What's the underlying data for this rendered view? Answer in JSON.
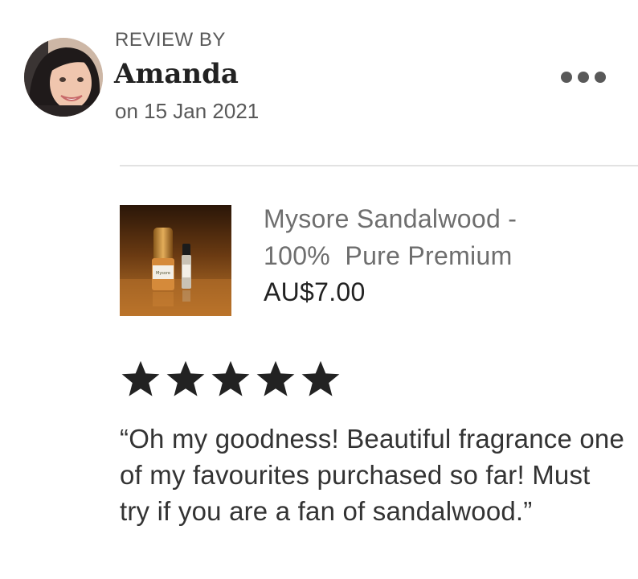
{
  "review": {
    "header_label": "REVIEW BY",
    "reviewer_name": "Amanda",
    "date": "on 15 Jan 2021",
    "more_options_icon": "more-horizontal-icon"
  },
  "product": {
    "title": "Mysore Sandalwood -\n100%  Pure Premium",
    "price": "AU$7.00",
    "image_label": "Mysore Sandalwood"
  },
  "rating": {
    "stars": 5,
    "max": 5,
    "star_color": "#222222"
  },
  "review_text": "“Oh my goodness! Beautiful fragrance one of my favourites purchased so far! Must try if you are a fan of sandalwood.”",
  "colors": {
    "text_primary": "#222222",
    "text_secondary": "#595959",
    "text_product": "#6e6e6e",
    "divider": "#e2e2e2"
  }
}
